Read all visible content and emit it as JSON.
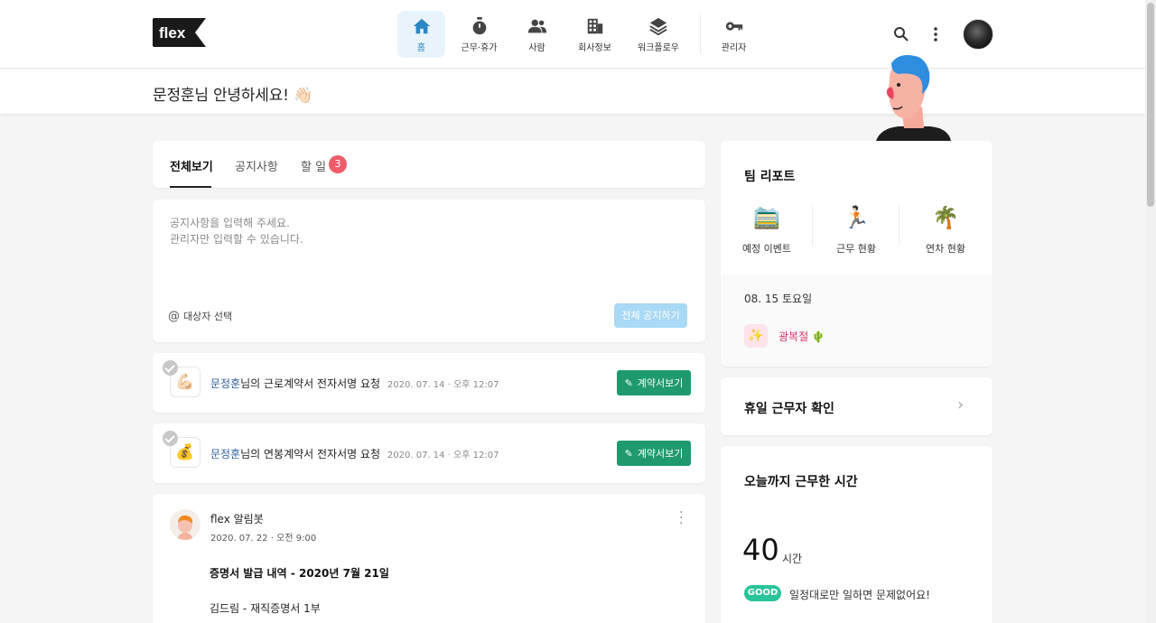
{
  "brand": {
    "logo_text": "flex"
  },
  "nav": [
    {
      "label": "홈",
      "icon": "home-icon"
    },
    {
      "label": "근무·휴가",
      "icon": "stopwatch-icon"
    },
    {
      "label": "사람",
      "icon": "people-icon"
    },
    {
      "label": "회사정보",
      "icon": "building-icon"
    },
    {
      "label": "워크플로우",
      "icon": "layers-icon"
    },
    {
      "label": "관리자",
      "icon": "key-icon"
    }
  ],
  "greeting": {
    "text": "문정훈님 안녕하세요! 👋🏻"
  },
  "tabs": [
    {
      "label": "전체보기"
    },
    {
      "label": "공지사항"
    },
    {
      "label": "할 일",
      "badge": "3"
    }
  ],
  "notice": {
    "placeholder_line1": "공지사항을 입력해 주세요.",
    "placeholder_line2": "관리자만 입력할 수 있습니다.",
    "target_label": "대상자 선택",
    "button_label": "전체 공지하기"
  },
  "tasks": [
    {
      "emoji": "💪🏻",
      "name": "문정훈",
      "text": "님의 근로계약서 전자서명 요청",
      "time": "2020. 07. 14 · 오후 12:07",
      "button": "계약서보기"
    },
    {
      "emoji": "💰",
      "name": "문정훈",
      "text": "님의 연봉계약서 전자서명 요청",
      "time": "2020. 07. 14 · 오후 12:07",
      "button": "계약서보기"
    }
  ],
  "post": {
    "author": "flex 알림봇",
    "date": "2020. 07. 22 · 오전 9:00",
    "title": "증명서 발급 내역 - 2020년 7월 21일",
    "line1": "김드림 - 재직증명서 1부"
  },
  "team_report": {
    "title": "팀 리포트",
    "items": [
      {
        "label": "예정 이벤트",
        "icon": "🚞"
      },
      {
        "label": "근무 현황",
        "icon": "🏃🏻"
      },
      {
        "label": "연차 현황",
        "icon": "🌴"
      }
    ],
    "date": "08. 15   토요일",
    "holiday": "광복절 🌵",
    "holiday_icon": "✨"
  },
  "holiday_workers": {
    "title": "휴일 근무자 확인"
  },
  "worktime": {
    "title": "오늘까지 근무한 시간",
    "hours": "40",
    "unit": "시간",
    "badge": "GOOD",
    "message": "일정대로만 일하면 문제없어요!"
  },
  "colors": {
    "accent_blue": "#2b86c4",
    "green_button": "#1f9a6e",
    "badge_red": "#ee5c6a",
    "good_green": "#29c49a"
  }
}
